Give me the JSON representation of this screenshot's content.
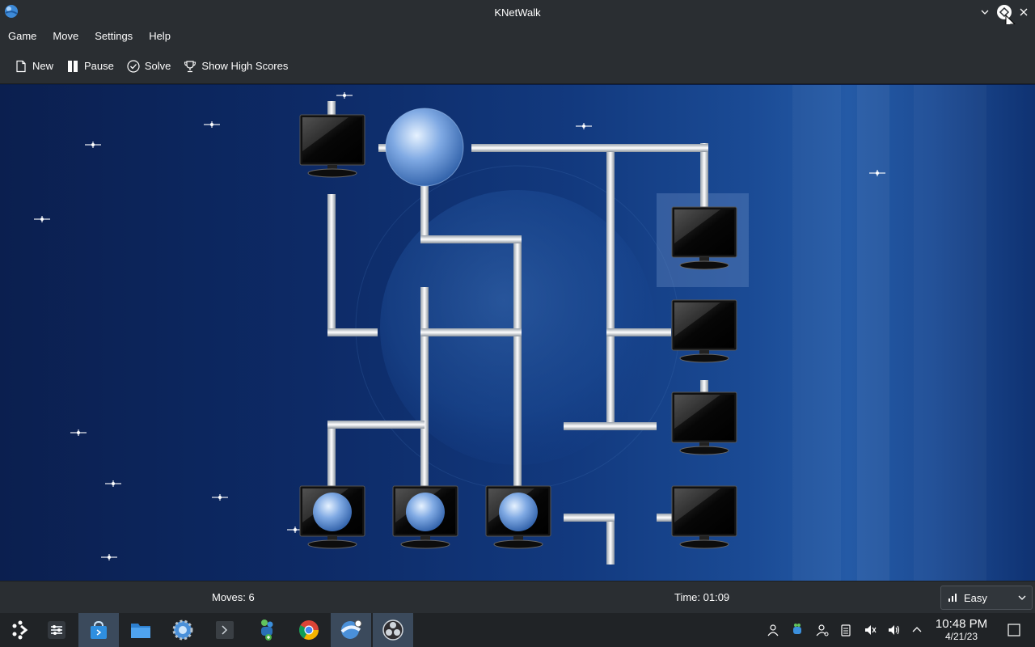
{
  "window": {
    "title": "KNetWalk"
  },
  "menu": {
    "items": [
      "Game",
      "Move",
      "Settings",
      "Help"
    ]
  },
  "toolbar": {
    "new_label": "New",
    "pause_label": "Pause",
    "solve_label": "Solve",
    "highscores_label": "Show High Scores"
  },
  "status": {
    "moves": "Moves: 6",
    "time": "Time: 01:09",
    "difficulty": "Easy"
  },
  "taskbar": {
    "apps": [
      "application-launcher-icon",
      "system-settings-icon",
      "discover-store-icon",
      "dolphin-files-icon",
      "steam-settings-icon",
      "terminal-icon",
      "protonup-icon",
      "chrome-icon",
      "knetwalk-icon",
      "obs-icon"
    ],
    "clock_time": "10:48 PM",
    "clock_date": "4/21/23"
  },
  "colors": {
    "chrome": "#2a2e32",
    "taskbar": "#202326",
    "board_dark": "#0b1f4f",
    "accent": "#3daee9"
  }
}
